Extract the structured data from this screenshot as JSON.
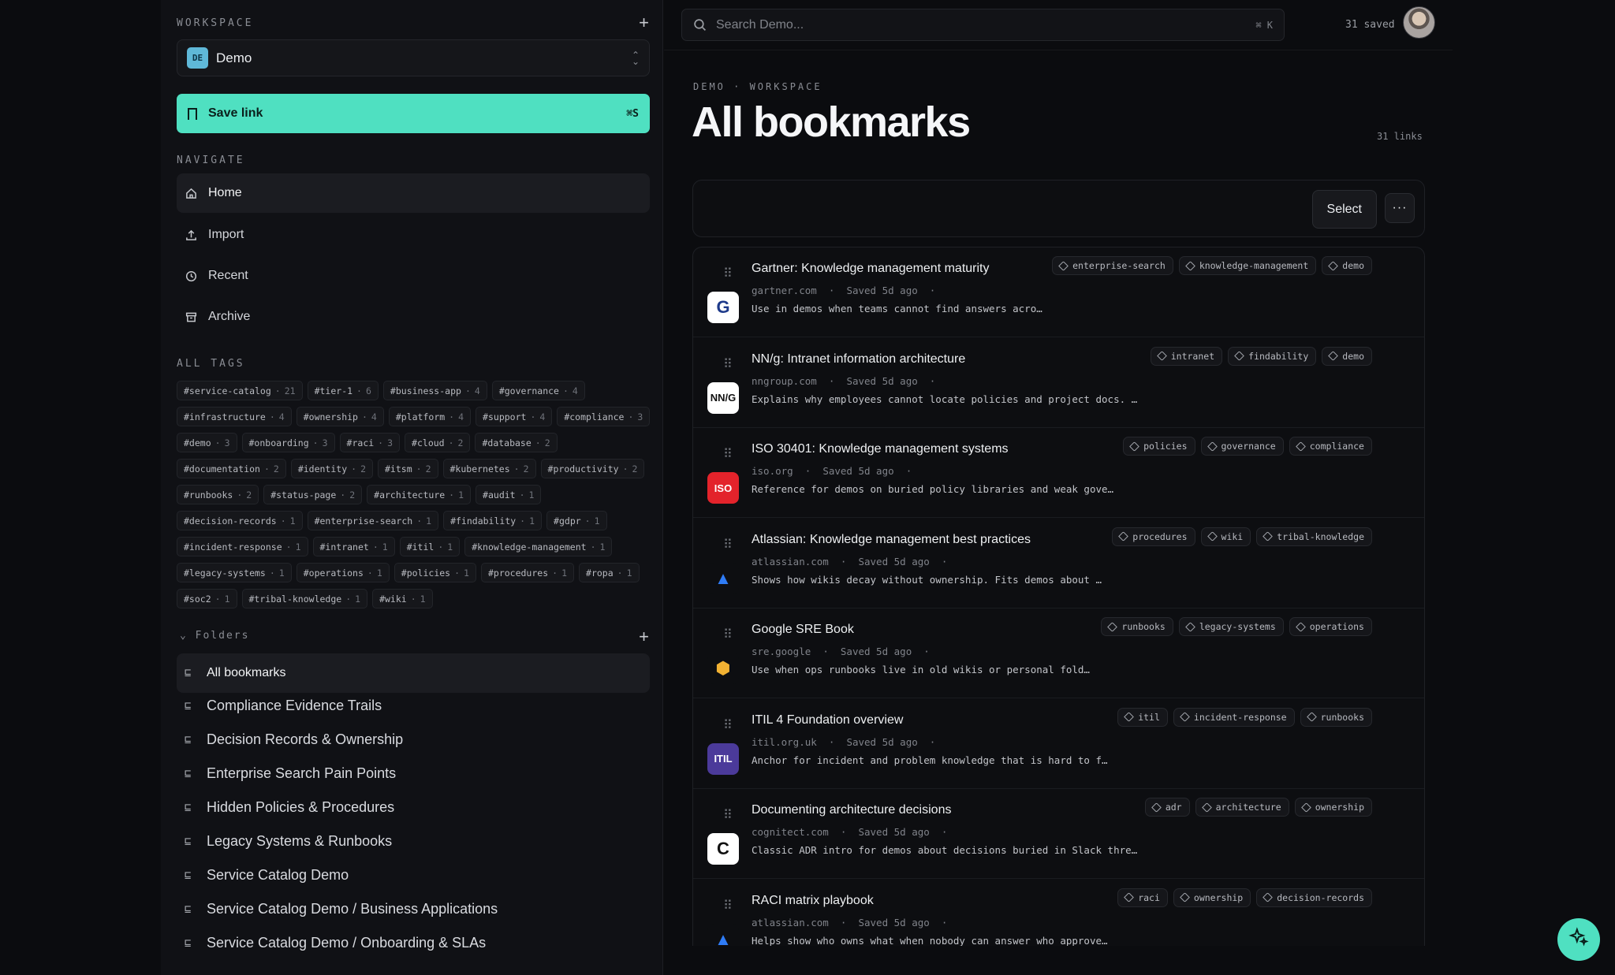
{
  "sidebar": {
    "workspace_label": "WORKSPACE",
    "workspace": {
      "badge": "DE",
      "name": "Demo"
    },
    "save_link": {
      "label": "Save link",
      "shortcut": "⌘S"
    },
    "navigate_label": "NAVIGATE",
    "nav": [
      {
        "label": "Home",
        "icon": "home-icon",
        "active": true
      },
      {
        "label": "Import",
        "icon": "upload-icon",
        "active": false
      },
      {
        "label": "Recent",
        "icon": "clock-icon",
        "active": false
      },
      {
        "label": "Archive",
        "icon": "archive-icon",
        "active": false
      }
    ],
    "all_tags_label": "ALL TAGS",
    "tags": [
      {
        "name": "#service-catalog",
        "count": "21"
      },
      {
        "name": "#tier-1",
        "count": "6"
      },
      {
        "name": "#business-app",
        "count": "4"
      },
      {
        "name": "#governance",
        "count": "4"
      },
      {
        "name": "#infrastructure",
        "count": "4"
      },
      {
        "name": "#ownership",
        "count": "4"
      },
      {
        "name": "#platform",
        "count": "4"
      },
      {
        "name": "#support",
        "count": "4"
      },
      {
        "name": "#compliance",
        "count": "3"
      },
      {
        "name": "#demo",
        "count": "3"
      },
      {
        "name": "#onboarding",
        "count": "3"
      },
      {
        "name": "#raci",
        "count": "3"
      },
      {
        "name": "#cloud",
        "count": "2"
      },
      {
        "name": "#database",
        "count": "2"
      },
      {
        "name": "#documentation",
        "count": "2"
      },
      {
        "name": "#identity",
        "count": "2"
      },
      {
        "name": "#itsm",
        "count": "2"
      },
      {
        "name": "#kubernetes",
        "count": "2"
      },
      {
        "name": "#productivity",
        "count": "2"
      },
      {
        "name": "#runbooks",
        "count": "2"
      },
      {
        "name": "#status-page",
        "count": "2"
      },
      {
        "name": "#architecture",
        "count": "1"
      },
      {
        "name": "#audit",
        "count": "1"
      },
      {
        "name": "#decision-records",
        "count": "1"
      },
      {
        "name": "#enterprise-search",
        "count": "1"
      },
      {
        "name": "#findability",
        "count": "1"
      },
      {
        "name": "#gdpr",
        "count": "1"
      },
      {
        "name": "#incident-response",
        "count": "1"
      },
      {
        "name": "#intranet",
        "count": "1"
      },
      {
        "name": "#itil",
        "count": "1"
      },
      {
        "name": "#knowledge-management",
        "count": "1"
      },
      {
        "name": "#legacy-systems",
        "count": "1"
      },
      {
        "name": "#operations",
        "count": "1"
      },
      {
        "name": "#policies",
        "count": "1"
      },
      {
        "name": "#procedures",
        "count": "1"
      },
      {
        "name": "#ropa",
        "count": "1"
      },
      {
        "name": "#soc2",
        "count": "1"
      },
      {
        "name": "#tribal-knowledge",
        "count": "1"
      },
      {
        "name": "#wiki",
        "count": "1"
      }
    ],
    "folders_label": "Folders",
    "folders": [
      {
        "label": "All bookmarks",
        "active": true
      },
      {
        "label": "Compliance Evidence Trails",
        "active": false
      },
      {
        "label": "Decision Records & Ownership",
        "active": false
      },
      {
        "label": "Enterprise Search Pain Points",
        "active": false
      },
      {
        "label": "Hidden Policies & Procedures",
        "active": false
      },
      {
        "label": "Legacy Systems & Runbooks",
        "active": false
      },
      {
        "label": "Service Catalog Demo",
        "active": false
      },
      {
        "label": "Service Catalog Demo / Business Applications",
        "active": false
      },
      {
        "label": "Service Catalog Demo / Onboarding & SLAs",
        "active": false
      }
    ]
  },
  "topbar": {
    "search_placeholder": "Search Demo...",
    "search_shortcut": "⌘ K",
    "saved_count": "31 saved"
  },
  "main": {
    "breadcrumb": "DEMO · WORKSPACE",
    "title": "All bookmarks",
    "link_count": "31 links",
    "select_label": "Select",
    "more_label": "···",
    "bookmarks": [
      {
        "title": "Gartner: Knowledge management maturity",
        "domain": "gartner.com",
        "saved": "Saved 5d ago",
        "desc": "Use in demos when teams cannot find answers acro…",
        "tags": [
          "enterprise-search",
          "knowledge-management",
          "demo"
        ],
        "favicon": {
          "text": "G",
          "bg": "#ffffff",
          "fg": "#1e3a8a"
        }
      },
      {
        "title": "NN/g: Intranet information architecture",
        "domain": "nngroup.com",
        "saved": "Saved 5d ago",
        "desc": "Explains why employees cannot locate policies and project docs. …",
        "tags": [
          "intranet",
          "findability",
          "demo"
        ],
        "favicon": {
          "text": "NN/G",
          "bg": "#ffffff",
          "fg": "#111111"
        }
      },
      {
        "title": "ISO 30401: Knowledge management systems",
        "domain": "iso.org",
        "saved": "Saved 5d ago",
        "desc": "Reference for demos on buried policy libraries and weak gove…",
        "tags": [
          "policies",
          "governance",
          "compliance"
        ],
        "favicon": {
          "text": "ISO",
          "bg": "#e3232b",
          "fg": "#ffffff"
        }
      },
      {
        "title": "Atlassian: Knowledge management best practices",
        "domain": "atlassian.com",
        "saved": "Saved 5d ago",
        "desc": "Shows how wikis decay without ownership. Fits demos about …",
        "tags": [
          "procedures",
          "wiki",
          "tribal-knowledge"
        ],
        "favicon": {
          "text": "▲",
          "bg": "#0d0e11",
          "fg": "#2f7cf6"
        }
      },
      {
        "title": "Google SRE Book",
        "domain": "sre.google",
        "saved": "Saved 5d ago",
        "desc": "Use when ops runbooks live in old wikis or personal fold…",
        "tags": [
          "runbooks",
          "legacy-systems",
          "operations"
        ],
        "favicon": {
          "text": "⬢",
          "bg": "#0d0e11",
          "fg": "#f2b233"
        }
      },
      {
        "title": "ITIL 4 Foundation overview",
        "domain": "itil.org.uk",
        "saved": "Saved 5d ago",
        "desc": "Anchor for incident and problem knowledge that is hard to f…",
        "tags": [
          "itil",
          "incident-response",
          "runbooks"
        ],
        "favicon": {
          "text": "ITIL",
          "bg": "#4b3a9a",
          "fg": "#ffffff"
        }
      },
      {
        "title": "Documenting architecture decisions",
        "domain": "cognitect.com",
        "saved": "Saved 5d ago",
        "desc": "Classic ADR intro for demos about decisions buried in Slack thre…",
        "tags": [
          "adr",
          "architecture",
          "ownership"
        ],
        "favicon": {
          "text": "C",
          "bg": "#ffffff",
          "fg": "#111111"
        }
      },
      {
        "title": "RACI matrix playbook",
        "domain": "atlassian.com",
        "saved": "Saved 5d ago",
        "desc": "Helps show who owns what when nobody can answer who approve…",
        "tags": [
          "raci",
          "ownership",
          "decision-records"
        ],
        "favicon": {
          "text": "▲",
          "bg": "#0d0e11",
          "fg": "#2f7cf6"
        }
      }
    ]
  },
  "colors": {
    "accent": "#4fe0c1",
    "background": "#0b0c0f",
    "sidebar": "#101115"
  },
  "fab_icon": "sparkle-icon"
}
